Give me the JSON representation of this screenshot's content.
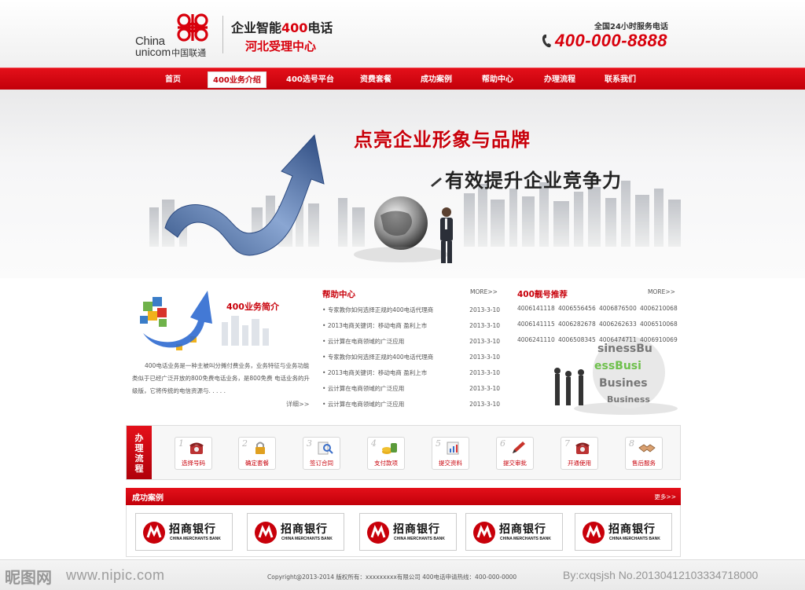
{
  "header": {
    "brand_line1": "China",
    "brand_line2": "unicom",
    "brand_cn": "中国联通",
    "slogan_prefix": "企业智能",
    "slogan_num": "400",
    "slogan_suffix": "电话",
    "subtitle": "河北受理中心",
    "hotline_label": "全国24小时服务电话",
    "hotline_number": "400-000-8888",
    "accent_color": "#d8000c"
  },
  "nav": {
    "items": [
      {
        "label": "首页"
      },
      {
        "label": "400业务介绍",
        "active": true
      },
      {
        "label": "400选号平台"
      },
      {
        "label": "资费套餐"
      },
      {
        "label": "成功案例"
      },
      {
        "label": "帮助中心"
      },
      {
        "label": "办理流程"
      },
      {
        "label": "联系我们"
      }
    ]
  },
  "banner": {
    "title1": "点亮企业形象与品牌",
    "title2": "有效提升企业竞争力"
  },
  "intro": {
    "title": "400业务简介",
    "text": "400电话业务是一种主被叫分摊付费业务，业务特征与业务功能类似于已经广泛开放的800免费电话业务，是800免费 电话业务的升级版，它将传统的电信资源与. . . . .",
    "more": "详细>>"
  },
  "help": {
    "title": "帮助中心",
    "more": "MORE>>",
    "items": [
      {
        "text": "专家教你如何选择正规的400电话代理商",
        "date": "2013-3-10"
      },
      {
        "text": "2013电商关键词：移动电商 盈利上市",
        "date": "2013-3-10"
      },
      {
        "text": "云计算在电商领域的广泛应用",
        "date": "2013-3-10"
      },
      {
        "text": "专家教你如何选择正规的400电话代理商",
        "date": "2013-3-10"
      },
      {
        "text": "2013电商关键词：移动电商 盈利上市",
        "date": "2013-3-10"
      },
      {
        "text": "云计算在电商领域的广泛应用",
        "date": "2013-3-10"
      },
      {
        "text": "云计算在电商领域的广泛应用",
        "date": "2013-3-10"
      }
    ]
  },
  "numbers": {
    "title": "400靓号推荐",
    "more": "MORE>>",
    "rows": [
      [
        "4006141118",
        "4006556456",
        "4006876500",
        "4006210068"
      ],
      [
        "4006141115",
        "4006282678",
        "4006262633",
        "4006510068"
      ],
      [
        "4006241110",
        "4006508345",
        "4006474711",
        "4006910069"
      ]
    ]
  },
  "process": {
    "label": "办理流程",
    "steps": [
      {
        "num": "1",
        "label": "选择号码",
        "icon": "phone-icon"
      },
      {
        "num": "2",
        "label": "确定套餐",
        "icon": "lock-icon"
      },
      {
        "num": "3",
        "label": "签订合同",
        "icon": "contract-search-icon"
      },
      {
        "num": "4",
        "label": "支付款项",
        "icon": "money-icon"
      },
      {
        "num": "5",
        "label": "提交资料",
        "icon": "chart-doc-icon"
      },
      {
        "num": "6",
        "label": "提交审批",
        "icon": "pen-icon"
      },
      {
        "num": "7",
        "label": "开通使用",
        "icon": "phone-icon"
      },
      {
        "num": "8",
        "label": "售后服务",
        "icon": "handshake-icon"
      }
    ]
  },
  "cases": {
    "title": "成功案例",
    "more": "更多>>",
    "items": [
      {
        "name": "招商银行",
        "en": "CHINA MERCHANTS BANK"
      },
      {
        "name": "招商银行",
        "en": "CHINA MERCHANTS BANK"
      },
      {
        "name": "招商银行",
        "en": "CHINA MERCHANTS BANK"
      },
      {
        "name": "招商银行",
        "en": "CHINA MERCHANTS BANK"
      },
      {
        "name": "招商银行",
        "en": "CHINA MERCHANTS BANK"
      }
    ]
  },
  "footer": {
    "text": "Copyright@2013-2014   版权所有：xxxxxxxxx有限公司   400电话申请热线：400-000-0000",
    "watermark_left": "昵图网",
    "watermark_url": "www.nipic.com",
    "watermark_right": "By:cxqsjsh No.20130412103334718000"
  }
}
